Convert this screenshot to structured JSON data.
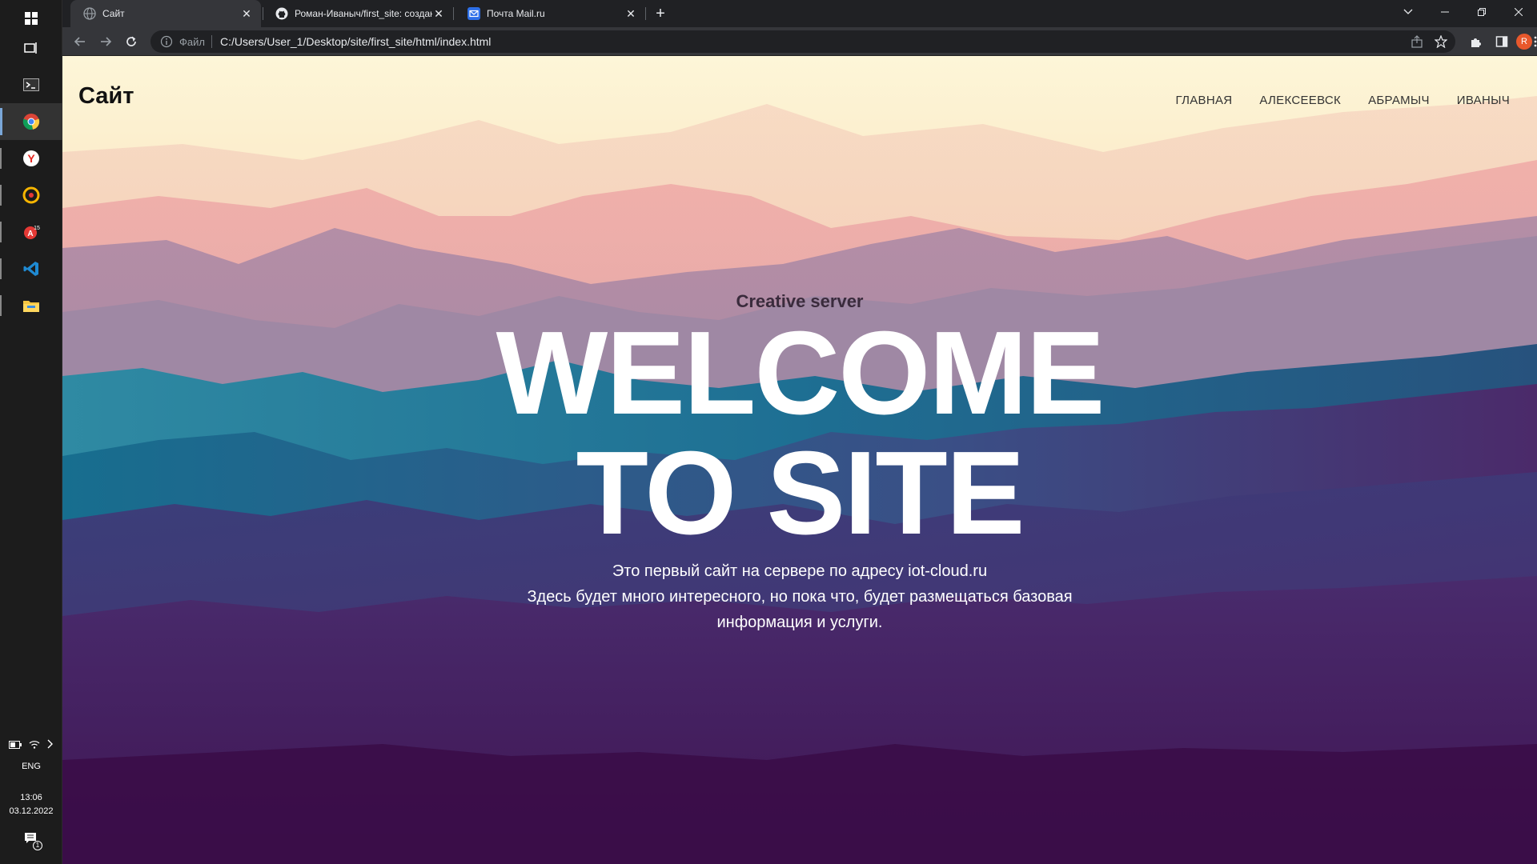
{
  "taskbar": {
    "icons": [
      "windows-start-icon",
      "task-view-icon",
      "terminal-icon",
      "chrome-icon",
      "yandex-browser-icon",
      "radio-app-icon",
      "acrobat-icon",
      "vscode-icon",
      "file-explorer-icon"
    ],
    "tray": {
      "lang": "ENG",
      "time": "13:06",
      "date": "03.12.2022",
      "notification_count": "1"
    }
  },
  "browser": {
    "tabs": [
      {
        "title": "Сайт",
        "favicon": "globe-icon",
        "active": true
      },
      {
        "title": "Роман-Иваныч/first_site: создан",
        "favicon": "github-icon",
        "active": false
      },
      {
        "title": "Почта Mail.ru",
        "favicon": "mail-icon",
        "active": false
      }
    ],
    "new_tab_label": "+",
    "address": {
      "scheme_label": "Файл",
      "url": "C:/Users/User_1/Desktop/site/first_site/html/index.html"
    },
    "profile_initial": "R",
    "colors": {
      "tabstrip": "#202124",
      "toolbar": "#35363a",
      "profile": "#e8582c"
    }
  },
  "site": {
    "logo": "Сайт",
    "nav": [
      "ГЛАВНАЯ",
      "АЛЕКСЕЕВСК",
      "АБРАМЫЧ",
      "ИВАНЫЧ"
    ],
    "hero": {
      "subtitle": "Creative server",
      "headline_line1": "WELCOME",
      "headline_line2": "TO SITE",
      "desc_line1": "Это первый сайт на сервере по адресу iot-cloud.ru",
      "desc_line2": "Здесь будет много интересного, но пока что, будет размещаться базовая",
      "desc_line3": "информация и услуги."
    },
    "colors": {
      "sky": "#fdf6d8",
      "pink": "#f5b7b0",
      "teal": "#1e7b96",
      "purple": "#4a2566",
      "deep": "#3c0f45"
    }
  }
}
